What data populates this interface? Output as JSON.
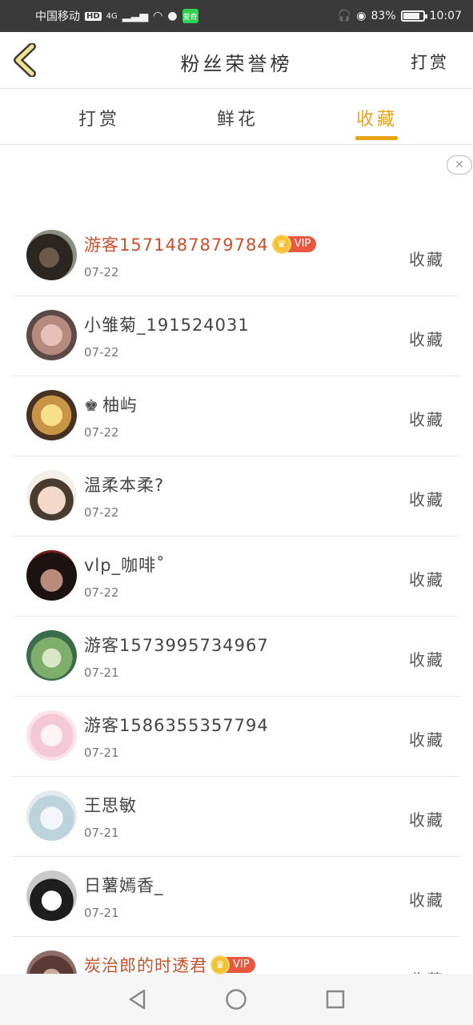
{
  "status_bar": {
    "carrier": "中国移动",
    "hd": "HD",
    "network": "4G",
    "battery_percent": "83%",
    "battery_level": 0.83,
    "time": "10:07",
    "app_label": "爱奇"
  },
  "header": {
    "title": "粉丝荣誉榜",
    "action": "打赏"
  },
  "tabs": [
    {
      "label": "打赏",
      "active": false
    },
    {
      "label": "鲜花",
      "active": false
    },
    {
      "label": "收藏",
      "active": true
    }
  ],
  "colors": {
    "accent": "#e8a317",
    "vip_name": "#c8502d",
    "vip_badge": "#e8573e"
  },
  "vip_label": "VIP",
  "list": [
    {
      "name": "游客1571487879784",
      "date": "07-22",
      "action": "收藏",
      "vip": true
    },
    {
      "name": "小雏菊_191524031",
      "date": "07-22",
      "action": "收藏",
      "vip": false
    },
    {
      "name": "柚屿",
      "date": "07-22",
      "action": "收藏",
      "vip": false,
      "king": "♚"
    },
    {
      "name": "温柔本柔?",
      "date": "07-22",
      "action": "收藏",
      "vip": false
    },
    {
      "name": "vlp_咖啡˚",
      "date": "07-22",
      "action": "收藏",
      "vip": false
    },
    {
      "name": "游客1573995734967",
      "date": "07-21",
      "action": "收藏",
      "vip": false
    },
    {
      "name": "游客1586355357794",
      "date": "07-21",
      "action": "收藏",
      "vip": false
    },
    {
      "name": "王思敏",
      "date": "07-21",
      "action": "收藏",
      "vip": false
    },
    {
      "name": "日薯嫣香_",
      "date": "07-21",
      "action": "收藏",
      "vip": false
    },
    {
      "name": "炭治郎的时透君",
      "date": "",
      "action": "收藏",
      "vip": true
    }
  ]
}
